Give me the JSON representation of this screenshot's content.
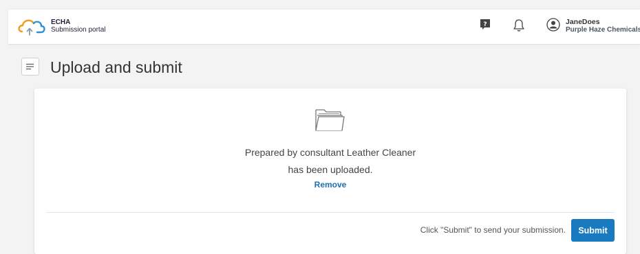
{
  "header": {
    "brand_line1": "ECHA",
    "brand_line2": "Submission portal",
    "user_name": "JaneDoes",
    "organisation": "Purple Haze Chemicals",
    "icons": {
      "logo": "echa-cloud-upload-logo",
      "help": "help-icon",
      "notifications": "bell-icon",
      "account": "avatar-icon"
    }
  },
  "page": {
    "title": "Upload and submit",
    "menu_icon": "menu-icon"
  },
  "upload": {
    "folder_icon": "folder-icon",
    "message_line1": "Prepared by consultant Leather Cleaner",
    "message_line2": "has been uploaded.",
    "remove_label": "Remove"
  },
  "footer": {
    "hint": "Click \"Submit\" to send your submission.",
    "submit_label": "Submit"
  },
  "colors": {
    "accent": "#1a7abf",
    "link": "#1a6fb3",
    "background": "#f3f3f3",
    "logo_orange": "#f39a1e",
    "logo_blue": "#2b8fd6"
  }
}
